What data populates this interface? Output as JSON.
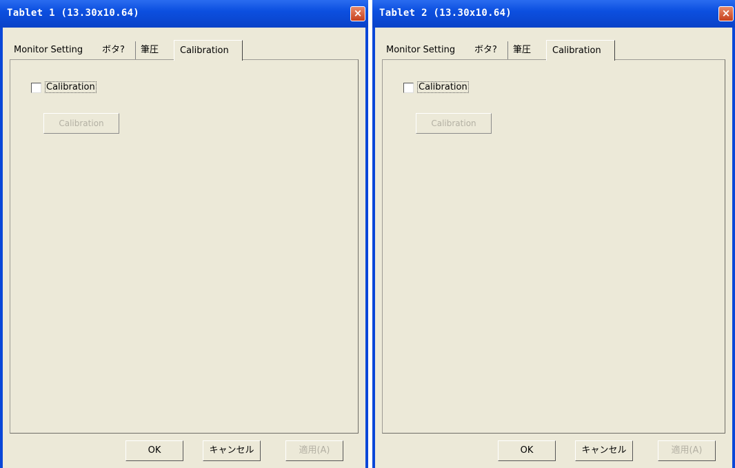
{
  "dialogs": [
    {
      "title": "Tablet 1 (13.30x10.64)",
      "close_icon": "×",
      "tabs": [
        "Monitor Setting",
        "ボタ?",
        "筆圧",
        "Calibration"
      ],
      "active_tab": "Calibration",
      "checkbox_label": "Calibration",
      "checkbox_checked": false,
      "calibration_button": "Calibration",
      "buttons": {
        "ok": "OK",
        "cancel": "キャンセル",
        "apply": "適用(A)"
      }
    },
    {
      "title": "Tablet 2 (13.30x10.64)",
      "close_icon": "×",
      "tabs": [
        "Monitor Setting",
        "ボタ?",
        "筆圧",
        "Calibration"
      ],
      "active_tab": "Calibration",
      "checkbox_label": "Calibration",
      "checkbox_checked": false,
      "calibration_button": "Calibration",
      "buttons": {
        "ok": "OK",
        "cancel": "キャンセル",
        "apply": "適用(A)"
      }
    }
  ],
  "colors": {
    "title_bar": "#0c4fe0",
    "dialog_face": "#ece9d8",
    "close_button": "#d65a34",
    "disabled_text": "#b3b0a3"
  }
}
